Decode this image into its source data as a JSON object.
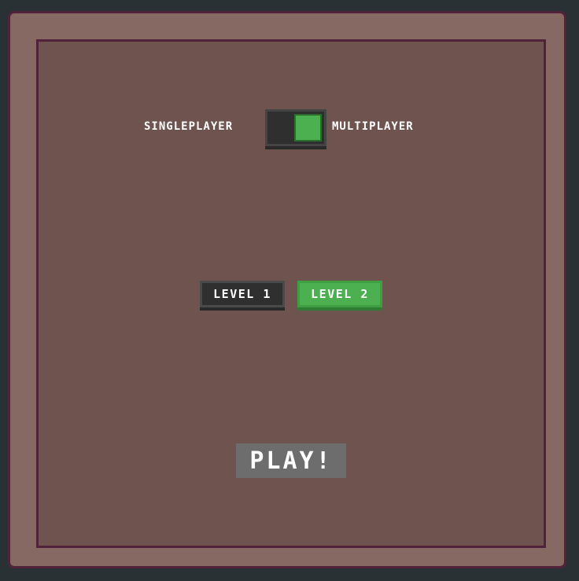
{
  "mode_select": {
    "left_label": "SINGLEPLAYER",
    "right_label": "MULTIPLAYER",
    "toggle_state": "multiplayer"
  },
  "levels": [
    {
      "label": "LEVEL 1",
      "selected": false
    },
    {
      "label": "LEVEL 2",
      "selected": true
    }
  ],
  "play_button": {
    "label": "PLAY!"
  },
  "colors": {
    "background": "#293134",
    "frame": "#876964",
    "panel": "#6e534e",
    "border": "#51233b",
    "accent_green": "#4caf50",
    "button_dark": "#2f2f2f",
    "play_gray": "#6d6d6d"
  }
}
